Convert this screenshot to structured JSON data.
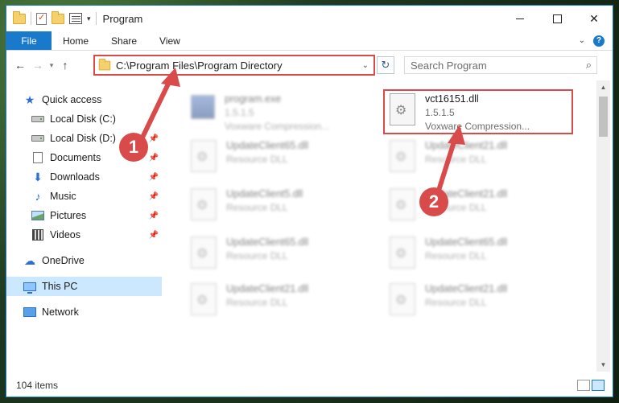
{
  "window": {
    "title": "Program",
    "caption": {
      "minimize": "",
      "maximize": "",
      "close": "✕"
    }
  },
  "ribbon": {
    "tabs": [
      "File",
      "Home",
      "Share",
      "View"
    ],
    "help": "?"
  },
  "address": {
    "path": "C:\\Program Files\\Program Directory",
    "search_placeholder": "Search Program"
  },
  "nav": {
    "quick_access": "Quick access",
    "items": [
      {
        "label": "Local Disk (C:)",
        "icon": "disk-icon"
      },
      {
        "label": "Local Disk (D:)",
        "icon": "disk-icon"
      },
      {
        "label": "Documents",
        "icon": "documents-icon"
      },
      {
        "label": "Downloads",
        "icon": "downloads-icon"
      },
      {
        "label": "Music",
        "icon": "music-icon"
      },
      {
        "label": "Pictures",
        "icon": "pictures-icon"
      },
      {
        "label": "Videos",
        "icon": "videos-icon"
      }
    ],
    "onedrive": "OneDrive",
    "this_pc": "This PC",
    "network": "Network"
  },
  "files": [
    {
      "name": "program.exe",
      "line2": "1.5.1.5",
      "line3": "Voxware Compression..."
    },
    {
      "name": "vct16151.dll",
      "line2": "1.5.1.5",
      "line3": "Voxware Compression..."
    },
    {
      "name": "UpdateClient65.dll",
      "line2": "Resource DLL"
    },
    {
      "name": "UpdateClient21.dll",
      "line2": "Resource DLL"
    },
    {
      "name": "UpdateClient5.dll",
      "line2": "Resource DLL"
    },
    {
      "name": "UpdateClient21.dll",
      "line2": "Resource DLL"
    },
    {
      "name": "UpdateClient65.dll",
      "line2": "Resource DLL"
    },
    {
      "name": "UpdateClient65.dll",
      "line2": "Resource DLL"
    },
    {
      "name": "UpdateClient21.dll",
      "line2": "Resource DLL"
    },
    {
      "name": "UpdateClient21.dll",
      "line2": "Resource DLL"
    }
  ],
  "status": {
    "count": "104 items"
  },
  "annotations": {
    "step1": "1",
    "step2": "2"
  },
  "colors": {
    "accent": "#1979ca",
    "annotation": "#d94b4b",
    "selection": "#cce8ff"
  }
}
